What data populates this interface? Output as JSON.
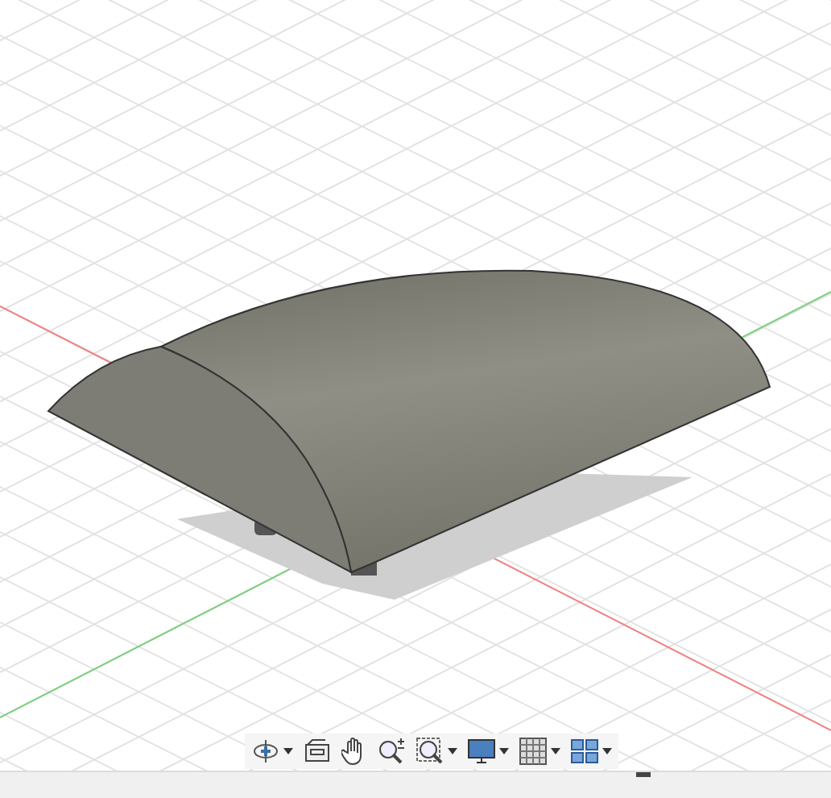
{
  "viewport": {
    "kind": "scene"
  },
  "toolbar": {
    "tools": [
      {
        "kind": "orbit",
        "has_menu": true
      },
      {
        "kind": "look-at",
        "has_menu": false
      },
      {
        "kind": "pan",
        "has_menu": false
      },
      {
        "kind": "zoom",
        "has_menu": false
      },
      {
        "kind": "fit",
        "has_menu": true
      },
      {
        "kind": "display",
        "has_menu": true
      },
      {
        "kind": "grid",
        "has_menu": true
      },
      {
        "kind": "viewports",
        "has_menu": true
      }
    ]
  }
}
